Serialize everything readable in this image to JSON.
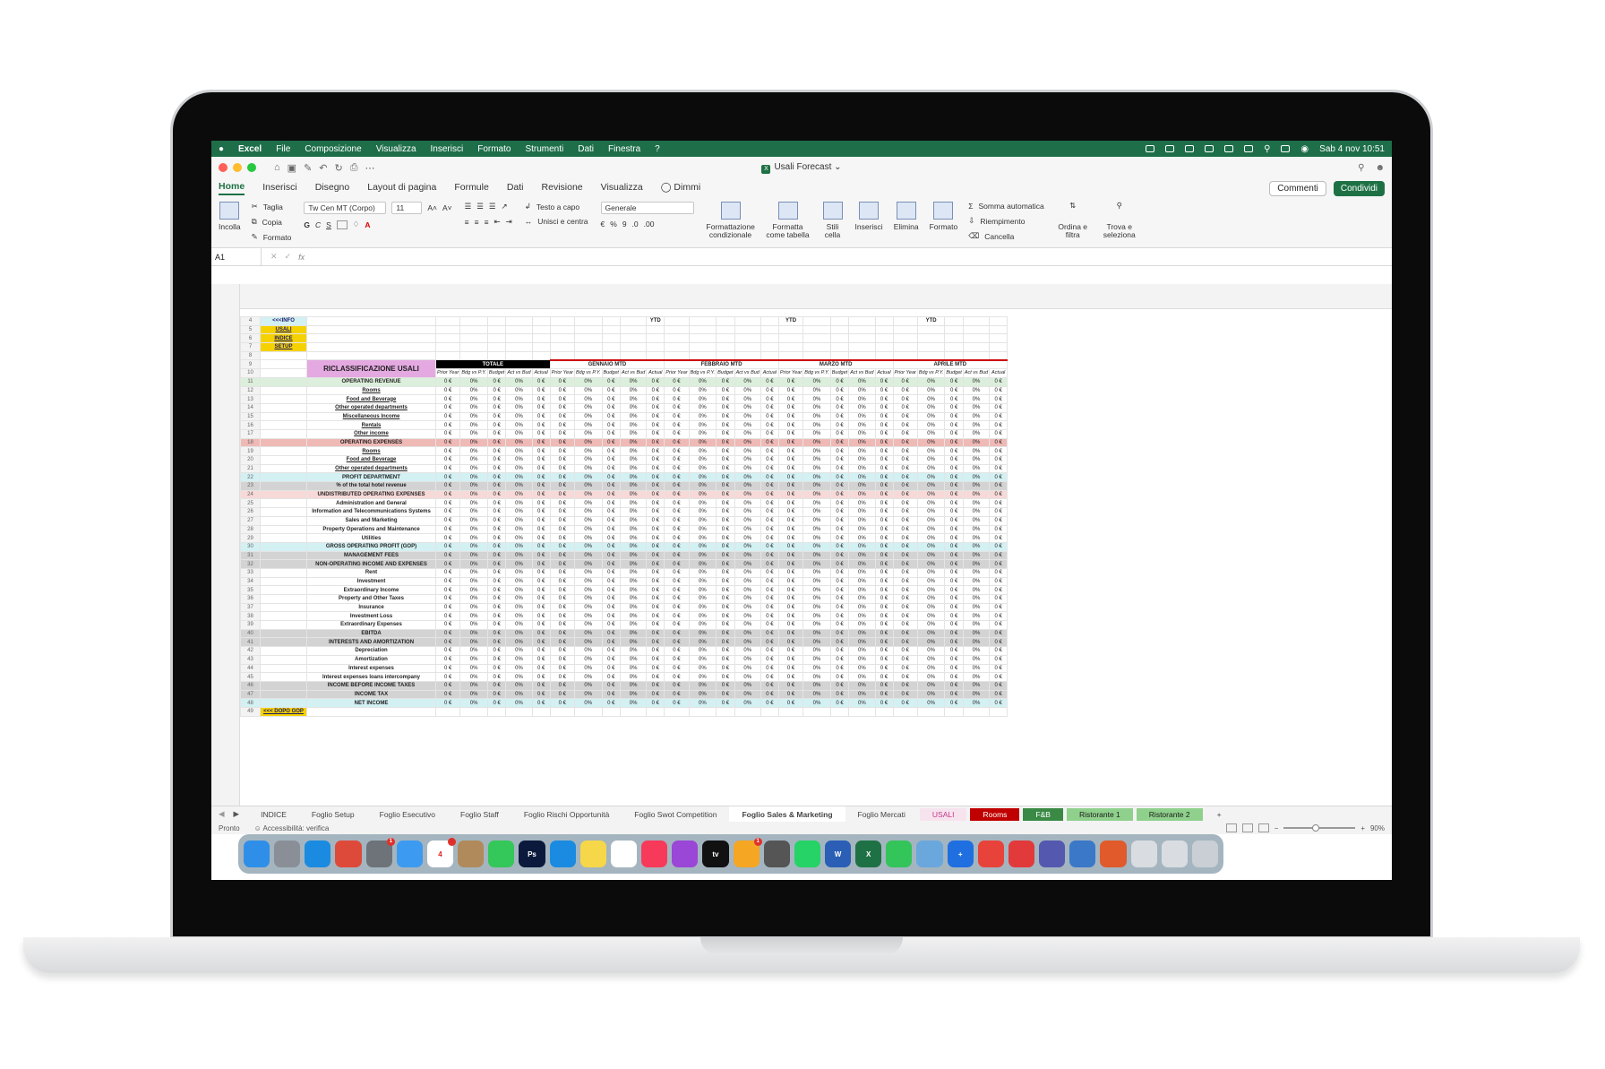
{
  "menubar": {
    "apple": "",
    "items": [
      "Excel",
      "File",
      "Composizione",
      "Visualizza",
      "Inserisci",
      "Formato",
      "Strumenti",
      "Dati",
      "Finestra",
      "?"
    ],
    "clock": "Sab 4 nov  10:51"
  },
  "window": {
    "title": "Usali Forecast"
  },
  "ribbon_tabs": [
    "Home",
    "Inserisci",
    "Disegno",
    "Layout di pagina",
    "Formule",
    "Dati",
    "Revisione",
    "Visualizza",
    "Dimmi"
  ],
  "buttons": {
    "comments": "Commenti",
    "share": "Condividi"
  },
  "ribbon": {
    "paste": "Incolla",
    "cut": "Taglia",
    "copy": "Copia",
    "format_painter": "Formato",
    "font": "Tw Cen MT (Corpo)",
    "size": "11",
    "wrap": "Testo a capo",
    "merge": "Unisci e centra",
    "number_format": "Generale",
    "cond_format": "Formattazione condizionale",
    "format_table": "Formatta come tabella",
    "cell_styles": "Stili cella",
    "insert": "Inserisci",
    "delete": "Elimina",
    "format": "Formato",
    "autosum": "Somma automatica",
    "fill": "Riempimento",
    "clear": "Cancella",
    "sort": "Ordina e filtra",
    "find": "Trova e seleziona"
  },
  "formula_bar": {
    "cell": "A1",
    "fx": "fx"
  },
  "sheet": {
    "links": [
      "<<<INFO",
      "USALI",
      "INDICE",
      "SETUP"
    ],
    "footer_link": "<<< DOPO GOP",
    "title": "RICLASSIFICAZIONE USALI",
    "groups": [
      "TOTALE",
      "GENNAIO MTD",
      "FEBBRAIO MTD",
      "MARZO MTD",
      "APRILE MTD"
    ],
    "subheads": [
      "Prior Year",
      "Bdg vs P.Y.",
      "Budget",
      "Act vs Bud",
      "Actual"
    ],
    "ytd": "YTD",
    "rows": [
      {
        "n": "11",
        "label": "OPERATING REVENUE",
        "style": "green"
      },
      {
        "n": "12",
        "label": "Rooms",
        "style": "item"
      },
      {
        "n": "13",
        "label": "Food and Beverage",
        "style": "item"
      },
      {
        "n": "14",
        "label": "Other operated departments",
        "style": "item"
      },
      {
        "n": "15",
        "label": "Miscellaneous Income",
        "style": "item"
      },
      {
        "n": "16",
        "label": "Rentals",
        "style": "item"
      },
      {
        "n": "17",
        "label": "Other income",
        "style": "item"
      },
      {
        "n": "18",
        "label": "OPERATING EXPENSES",
        "style": "red"
      },
      {
        "n": "19",
        "label": "Rooms",
        "style": "item"
      },
      {
        "n": "20",
        "label": "Food and Beverage",
        "style": "item"
      },
      {
        "n": "21",
        "label": "Other operated departments",
        "style": "item"
      },
      {
        "n": "22",
        "label": "PROFIT DEPARTMENT",
        "style": "cyan"
      },
      {
        "n": "23",
        "label": "% of the total hotel revenue",
        "style": "grey"
      },
      {
        "n": "24",
        "label": "UNDISTRIBUTED OPERATING EXPENSES",
        "style": "pink"
      },
      {
        "n": "25",
        "label": "Administration and General",
        "style": "ind"
      },
      {
        "n": "26",
        "label": "Information and Telecommunications Systems",
        "style": "ind"
      },
      {
        "n": "27",
        "label": "Sales and Marketing",
        "style": "ind"
      },
      {
        "n": "28",
        "label": "Property Operations and Maintenance",
        "style": "ind"
      },
      {
        "n": "29",
        "label": "Utilities",
        "style": "ind"
      },
      {
        "n": "30",
        "label": "GROSS OPERATING PROFIT (GOP)",
        "style": "cyan"
      },
      {
        "n": "31",
        "label": "MANAGEMENT FEES",
        "style": "grey"
      },
      {
        "n": "32",
        "label": "NON-OPERATING INCOME AND EXPENSES",
        "style": "grey"
      },
      {
        "n": "33",
        "label": "Rent",
        "style": "ind"
      },
      {
        "n": "34",
        "label": "Investment",
        "style": "ind"
      },
      {
        "n": "35",
        "label": "Extraordinary Income",
        "style": "ind"
      },
      {
        "n": "36",
        "label": "Property and Other Taxes",
        "style": "ind"
      },
      {
        "n": "37",
        "label": "Insurance",
        "style": "ind"
      },
      {
        "n": "38",
        "label": "Investment Loss",
        "style": "ind"
      },
      {
        "n": "39",
        "label": "Extraordinary Expenses",
        "style": "ind"
      },
      {
        "n": "40",
        "label": "EBITDA",
        "style": "grey"
      },
      {
        "n": "41",
        "label": "INTERESTS AND AMORTIZATION",
        "style": "grey"
      },
      {
        "n": "42",
        "label": "Depreciation",
        "style": "ind"
      },
      {
        "n": "43",
        "label": "Amortization",
        "style": "ind"
      },
      {
        "n": "44",
        "label": "Interest expenses",
        "style": "ind"
      },
      {
        "n": "45",
        "label": "Interest expenses loans intercompany",
        "style": "ind"
      },
      {
        "n": "46",
        "label": "INCOME BEFORE INCOME TAXES",
        "style": "grey"
      },
      {
        "n": "47",
        "label": "INCOME TAX",
        "style": "grey"
      },
      {
        "n": "48",
        "label": "NET INCOME",
        "style": "cyan"
      }
    ],
    "cell_money": "0 €",
    "cell_pct": "0%"
  },
  "sheet_tabs": [
    {
      "label": "INDICE"
    },
    {
      "label": "Foglio Setup"
    },
    {
      "label": "Foglio Esecutivo"
    },
    {
      "label": "Foglio Staff"
    },
    {
      "label": "Foglio Rischi Opportunità"
    },
    {
      "label": "Foglio Swot Competition"
    },
    {
      "label": "Foglio Sales & Marketing",
      "active": true
    },
    {
      "label": "Foglio Mercati"
    },
    {
      "label": "USALI",
      "color": "#f7e3ee",
      "text": "#c0398a"
    },
    {
      "label": "Rooms",
      "color": "#c00000"
    },
    {
      "label": "F&B",
      "color": "#3a8a45"
    },
    {
      "label": "Ristorante 1",
      "color": "#8fd18c",
      "text": "#1a1a1a"
    },
    {
      "label": "Ristorante 2",
      "color": "#8fd18c",
      "text": "#1a1a1a"
    }
  ],
  "status": {
    "ready": "Pronto",
    "accessibility": "Accessibilità: verifica",
    "zoom": "90%"
  },
  "dock": {
    "apps": [
      {
        "name": "finder",
        "label": "",
        "color": "#2f8fe8"
      },
      {
        "name": "launchpad",
        "label": "",
        "color": "#8a8f97"
      },
      {
        "name": "safari",
        "label": "",
        "color": "#1a8be0"
      },
      {
        "name": "chrome",
        "label": "",
        "color": "#de4a3a"
      },
      {
        "name": "settings",
        "label": "",
        "color": "#6e7379",
        "badge": "1"
      },
      {
        "name": "mail",
        "label": "",
        "color": "#3c9af0"
      },
      {
        "name": "calendar",
        "label": "4",
        "color": "#ffffff",
        "text": "#d22",
        "badge": "1"
      },
      {
        "name": "contacts",
        "label": "",
        "color": "#b08a5b"
      },
      {
        "name": "messages",
        "label": "",
        "color": "#34c759"
      },
      {
        "name": "photoshop",
        "label": "Ps",
        "color": "#0b1a3c"
      },
      {
        "name": "appstore",
        "label": "",
        "color": "#1a8be0"
      },
      {
        "name": "notes",
        "label": "",
        "color": "#f6d74a"
      },
      {
        "name": "reminders",
        "label": "",
        "color": "#ffffff"
      },
      {
        "name": "music",
        "label": "",
        "color": "#f73a5a"
      },
      {
        "name": "podcasts",
        "label": "",
        "color": "#9a46d6"
      },
      {
        "name": "appletv",
        "label": "tv",
        "color": "#111111"
      },
      {
        "name": "photos",
        "label": "",
        "color": "#f5a623",
        "badge": "1"
      },
      {
        "name": "calculator",
        "label": "",
        "color": "#555555"
      },
      {
        "name": "whatsapp",
        "label": "",
        "color": "#25d366"
      },
      {
        "name": "word",
        "label": "W",
        "color": "#2b5fb6"
      },
      {
        "name": "excel",
        "label": "X",
        "color": "#1e7145"
      },
      {
        "name": "facetime",
        "label": "",
        "color": "#33c45a"
      },
      {
        "name": "app-1",
        "label": "",
        "color": "#6aa7dd"
      },
      {
        "name": "app-2",
        "label": "+",
        "color": "#1f6fe0"
      },
      {
        "name": "app-3",
        "label": "",
        "color": "#e8433a"
      },
      {
        "name": "app-4",
        "label": "",
        "color": "#e23a3a"
      },
      {
        "name": "teams",
        "label": "",
        "color": "#5558af"
      },
      {
        "name": "app-5",
        "label": "",
        "color": "#3b78c8"
      },
      {
        "name": "app-6",
        "label": "",
        "color": "#e05a2b"
      },
      {
        "name": "app-7",
        "label": "",
        "color": "#d9dde1"
      },
      {
        "name": "app-8",
        "label": "",
        "color": "#d9dde1"
      },
      {
        "name": "trash",
        "label": "",
        "color": "#c9cfd4"
      }
    ]
  }
}
